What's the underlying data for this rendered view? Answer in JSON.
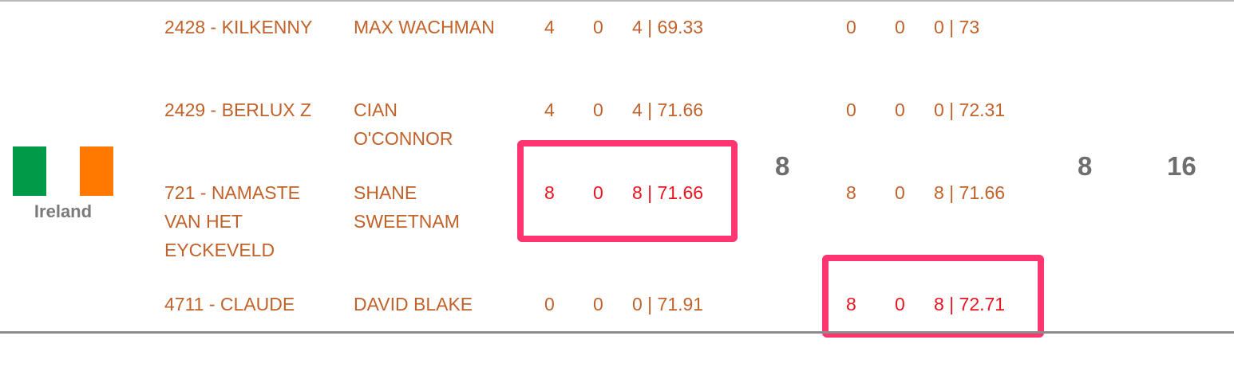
{
  "team": {
    "country": "Ireland",
    "flag_colors": [
      "#009a49",
      "#ffffff",
      "#ff7900"
    ],
    "round1_total": "8",
    "round2_total": "8",
    "team_total": "16"
  },
  "rows": [
    {
      "horse": "2428 - KILKENNY",
      "rider": "MAX WACHMAN",
      "r1_jump": "4",
      "r1_time": "0",
      "r1_total": "4 | 69.33",
      "r2_jump": "0",
      "r2_time": "0",
      "r2_total": "0 | 73"
    },
    {
      "horse": "2429 - BERLUX Z",
      "rider": "CIAN O'CONNOR",
      "r1_jump": "4",
      "r1_time": "0",
      "r1_total": "4 | 71.66",
      "r2_jump": "0",
      "r2_time": "0",
      "r2_total": "0 | 72.31"
    },
    {
      "horse": "721 - NAMASTE VAN HET EYCKEVELD",
      "rider": "SHANE SWEETNAM",
      "r1_jump": "8",
      "r1_time": "0",
      "r1_total": "8 | 71.66",
      "r2_jump": "8",
      "r2_time": "0",
      "r2_total": "8 | 71.66"
    },
    {
      "horse": "4711 - CLAUDE",
      "rider": "DAVID BLAKE",
      "r1_jump": "0",
      "r1_time": "0",
      "r1_total": "0 | 71.91",
      "r2_jump": "8",
      "r2_time": "0",
      "r2_total": "8 | 72.71"
    }
  ],
  "colors": {
    "text": "#c0622a",
    "highlight_text": "#e8141f",
    "highlight_border": "#ff3570"
  }
}
